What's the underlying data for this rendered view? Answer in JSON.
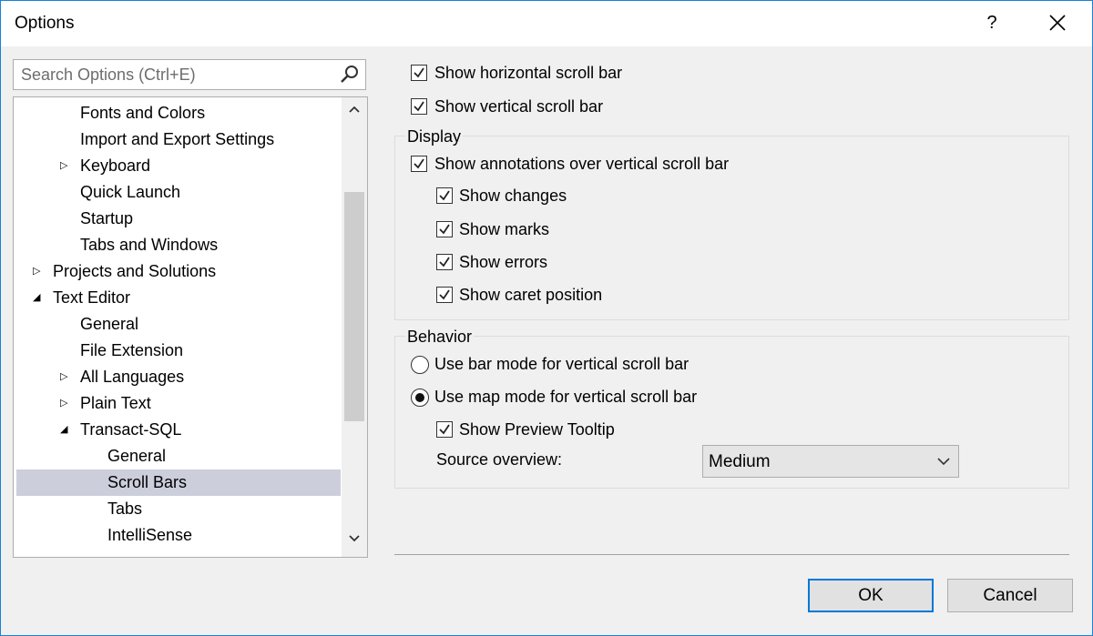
{
  "window": {
    "title": "Options",
    "help": "?"
  },
  "search": {
    "placeholder": "Search Options (Ctrl+E)"
  },
  "tree": {
    "items": [
      {
        "label": "Fonts and Colors",
        "expander": ""
      },
      {
        "label": "Import and Export Settings",
        "expander": ""
      },
      {
        "label": "Keyboard",
        "expander": "collapsed"
      },
      {
        "label": "Quick Launch",
        "expander": ""
      },
      {
        "label": "Startup",
        "expander": ""
      },
      {
        "label": "Tabs and Windows",
        "expander": ""
      },
      {
        "label": "Projects and Solutions",
        "expander": "collapsed"
      },
      {
        "label": "Text Editor",
        "expander": "expanded"
      },
      {
        "label": "General",
        "expander": ""
      },
      {
        "label": "File Extension",
        "expander": ""
      },
      {
        "label": "All Languages",
        "expander": "collapsed"
      },
      {
        "label": "Plain Text",
        "expander": "collapsed"
      },
      {
        "label": "Transact-SQL",
        "expander": "expanded"
      },
      {
        "label": "General",
        "expander": ""
      },
      {
        "label": "Scroll Bars",
        "expander": "",
        "selected": true
      },
      {
        "label": "Tabs",
        "expander": ""
      },
      {
        "label": "IntelliSense",
        "expander": ""
      }
    ]
  },
  "options": {
    "show_horizontal": {
      "label": "Show horizontal scroll bar",
      "checked": true
    },
    "show_vertical": {
      "label": "Show vertical scroll bar",
      "checked": true
    }
  },
  "display": {
    "title": "Display",
    "annotations": {
      "label": "Show annotations over vertical scroll bar",
      "checked": true
    },
    "changes": {
      "label": "Show changes",
      "checked": true
    },
    "marks": {
      "label": "Show marks",
      "checked": true
    },
    "errors": {
      "label": "Show errors",
      "checked": true
    },
    "caret": {
      "label": "Show caret position",
      "checked": true
    }
  },
  "behavior": {
    "title": "Behavior",
    "bar_mode": {
      "label": "Use bar mode for vertical scroll bar",
      "selected": false
    },
    "map_mode": {
      "label": "Use map mode for vertical scroll bar",
      "selected": true
    },
    "preview_tooltip": {
      "label": "Show Preview Tooltip",
      "checked": true
    },
    "source_overview": {
      "label": "Source overview:",
      "value": "Medium"
    }
  },
  "buttons": {
    "ok": "OK",
    "cancel": "Cancel"
  },
  "colors": {
    "accent": "#0078d7",
    "selected_row": "#cccedb",
    "window_border": "#1883d7"
  }
}
